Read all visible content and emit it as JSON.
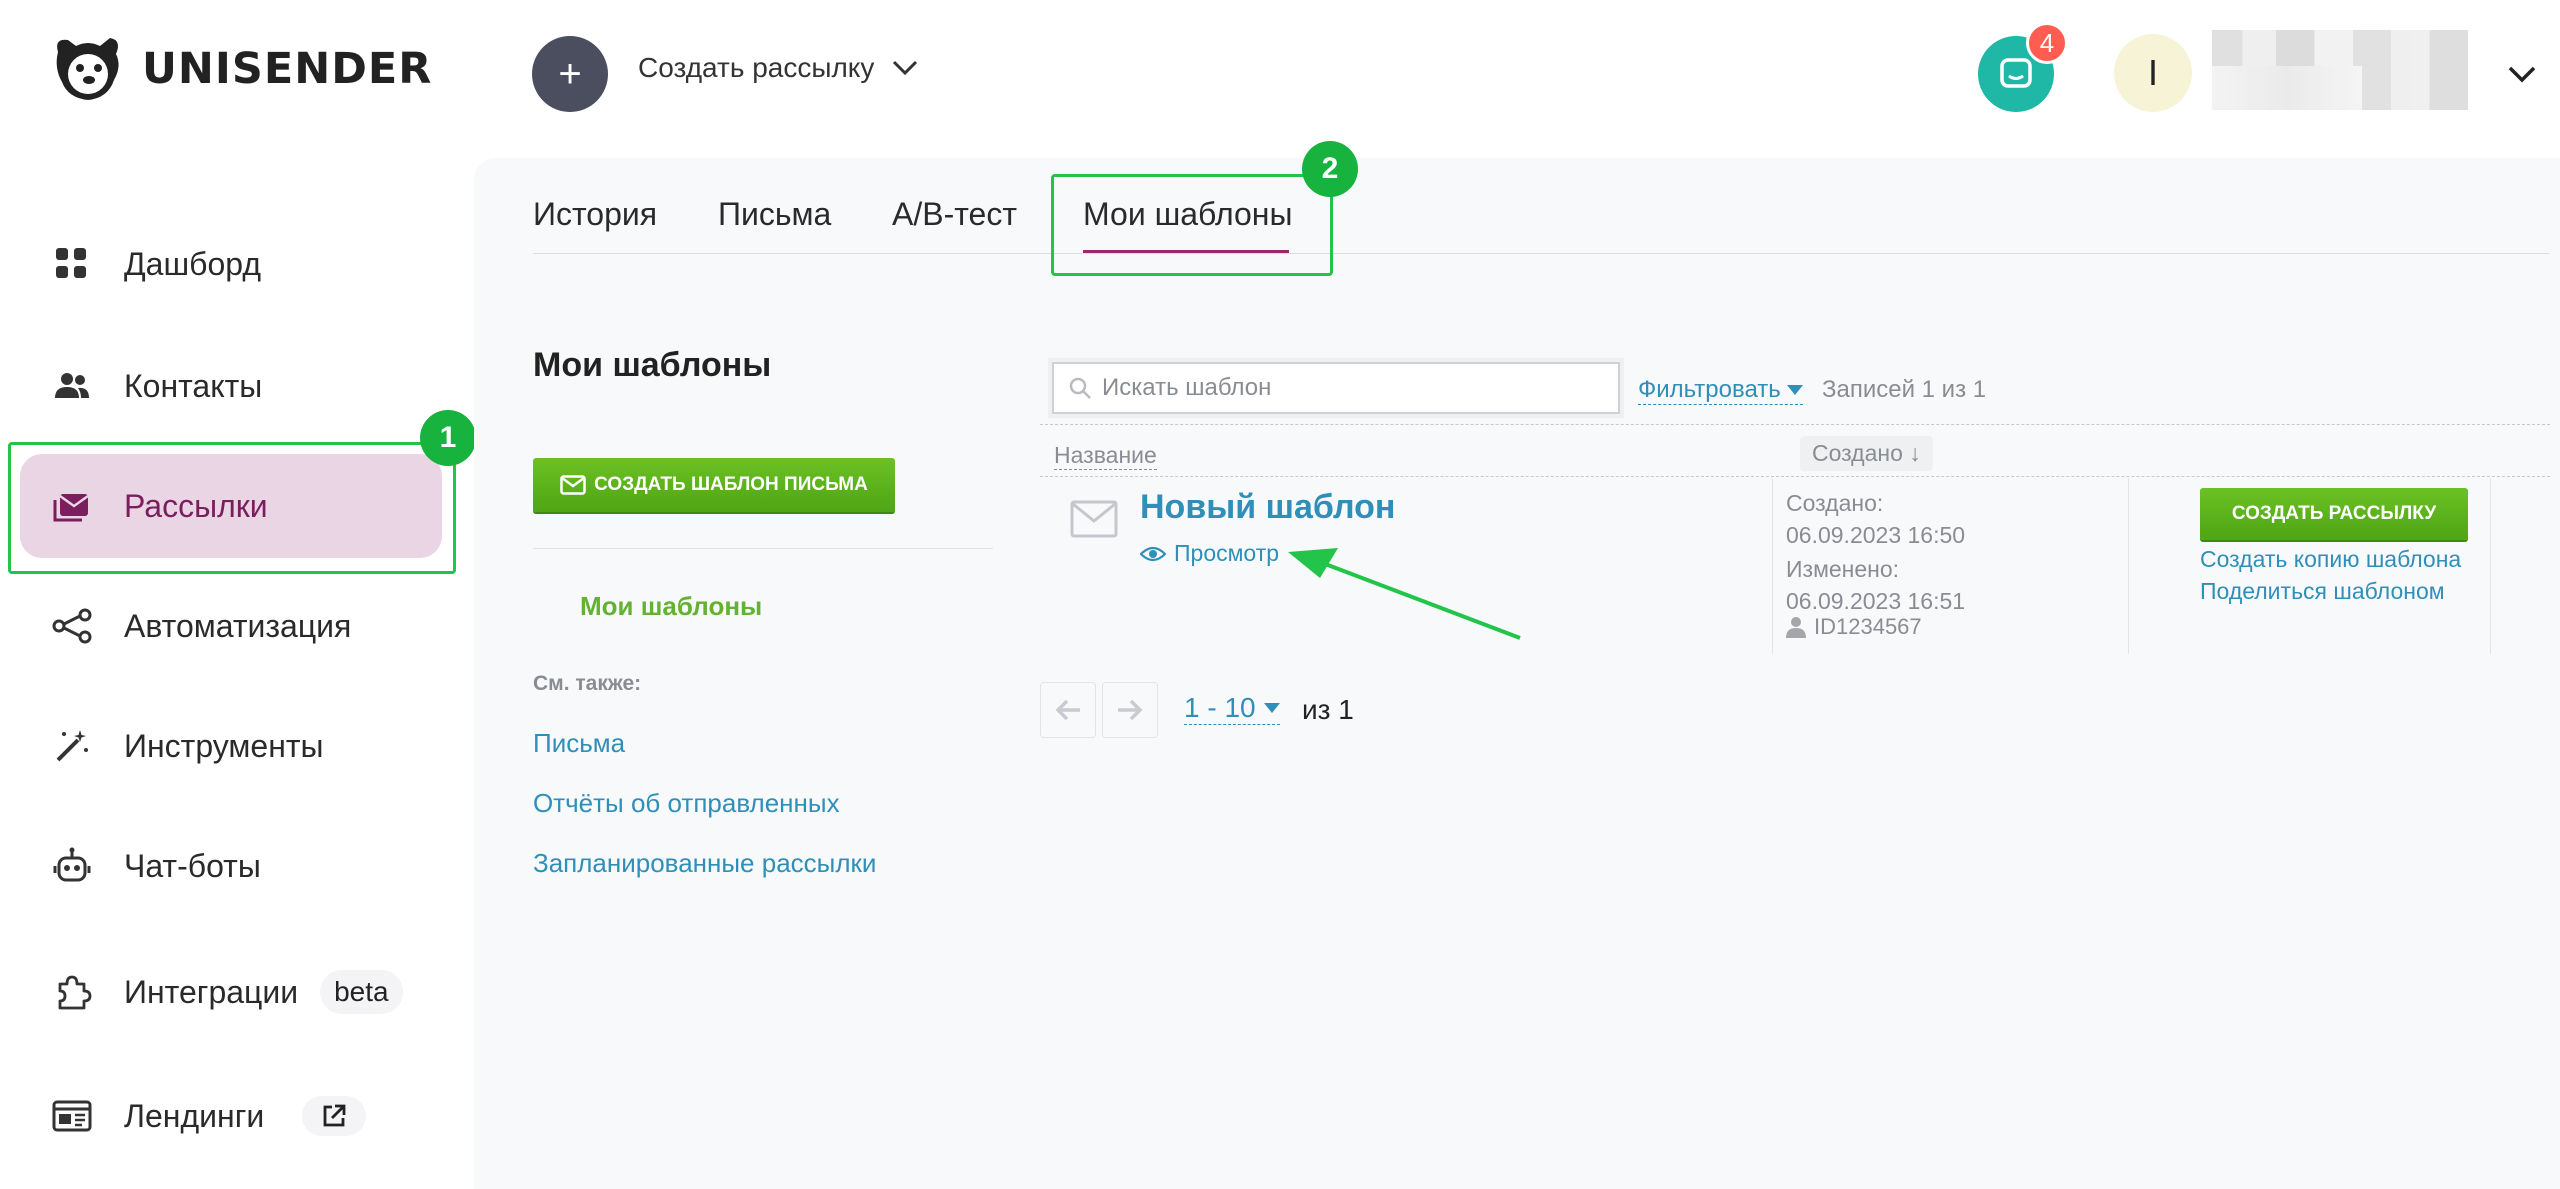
{
  "header": {
    "brand": "UNISENDER",
    "create_label": "Создать рассылку",
    "create_plus": "+",
    "notifications_count": "4",
    "avatar_initial": "I"
  },
  "sidebar": {
    "items": [
      {
        "label": "Дашборд",
        "icon": "dashboard-icon"
      },
      {
        "label": "Контакты",
        "icon": "contacts-icon"
      },
      {
        "label": "Рассылки",
        "icon": "mailings-icon",
        "active": true
      },
      {
        "label": "Автоматизация",
        "icon": "automation-icon"
      },
      {
        "label": "Инструменты",
        "icon": "magic-wand-icon"
      },
      {
        "label": "Чат-боты",
        "icon": "robot-icon"
      },
      {
        "label": "Интеграции",
        "icon": "puzzle-icon",
        "badge": "beta"
      },
      {
        "label": "Лендинги",
        "icon": "landing-icon",
        "external": true
      }
    ]
  },
  "annotations": {
    "one": "1",
    "two": "2"
  },
  "tabs": [
    {
      "label": "История"
    },
    {
      "label": "Письма"
    },
    {
      "label": "A/B-тест"
    },
    {
      "label": "Мои шаблоны",
      "active": true
    }
  ],
  "left": {
    "title": "Мои шаблоны",
    "create_template": "СОЗДАТЬ ШАБЛОН ПИСЬМА",
    "my_templates": "Мои шаблоны",
    "see_also": "См. также:",
    "links": [
      "Письма",
      "Отчёты об отправленных",
      "Запланированные рассылки"
    ]
  },
  "list": {
    "search_placeholder": "Искать шаблон",
    "filter": "Фильтровать",
    "records": "Записей 1 из 1",
    "col_name": "Название",
    "col_created": "Создано ↓",
    "row": {
      "name": "Новый шаблон",
      "preview": "Просмотр",
      "created_label": "Создано:",
      "created_at": "06.09.2023 16:50",
      "modified_label": "Изменено:",
      "modified_at": "06.09.2023 16:51",
      "author_id": "ID1234567",
      "create_mailing": "СОЗДАТЬ РАССЫЛКУ",
      "copy": "Создать копию шаблона",
      "share": "Поделиться шаблоном"
    },
    "pager": {
      "range": "1 - 10",
      "total": "из 1"
    }
  },
  "colors": {
    "accent": "#9a2a6b",
    "green": "#4fa514",
    "link": "#2f8fb8",
    "annotation": "#22c44a"
  }
}
